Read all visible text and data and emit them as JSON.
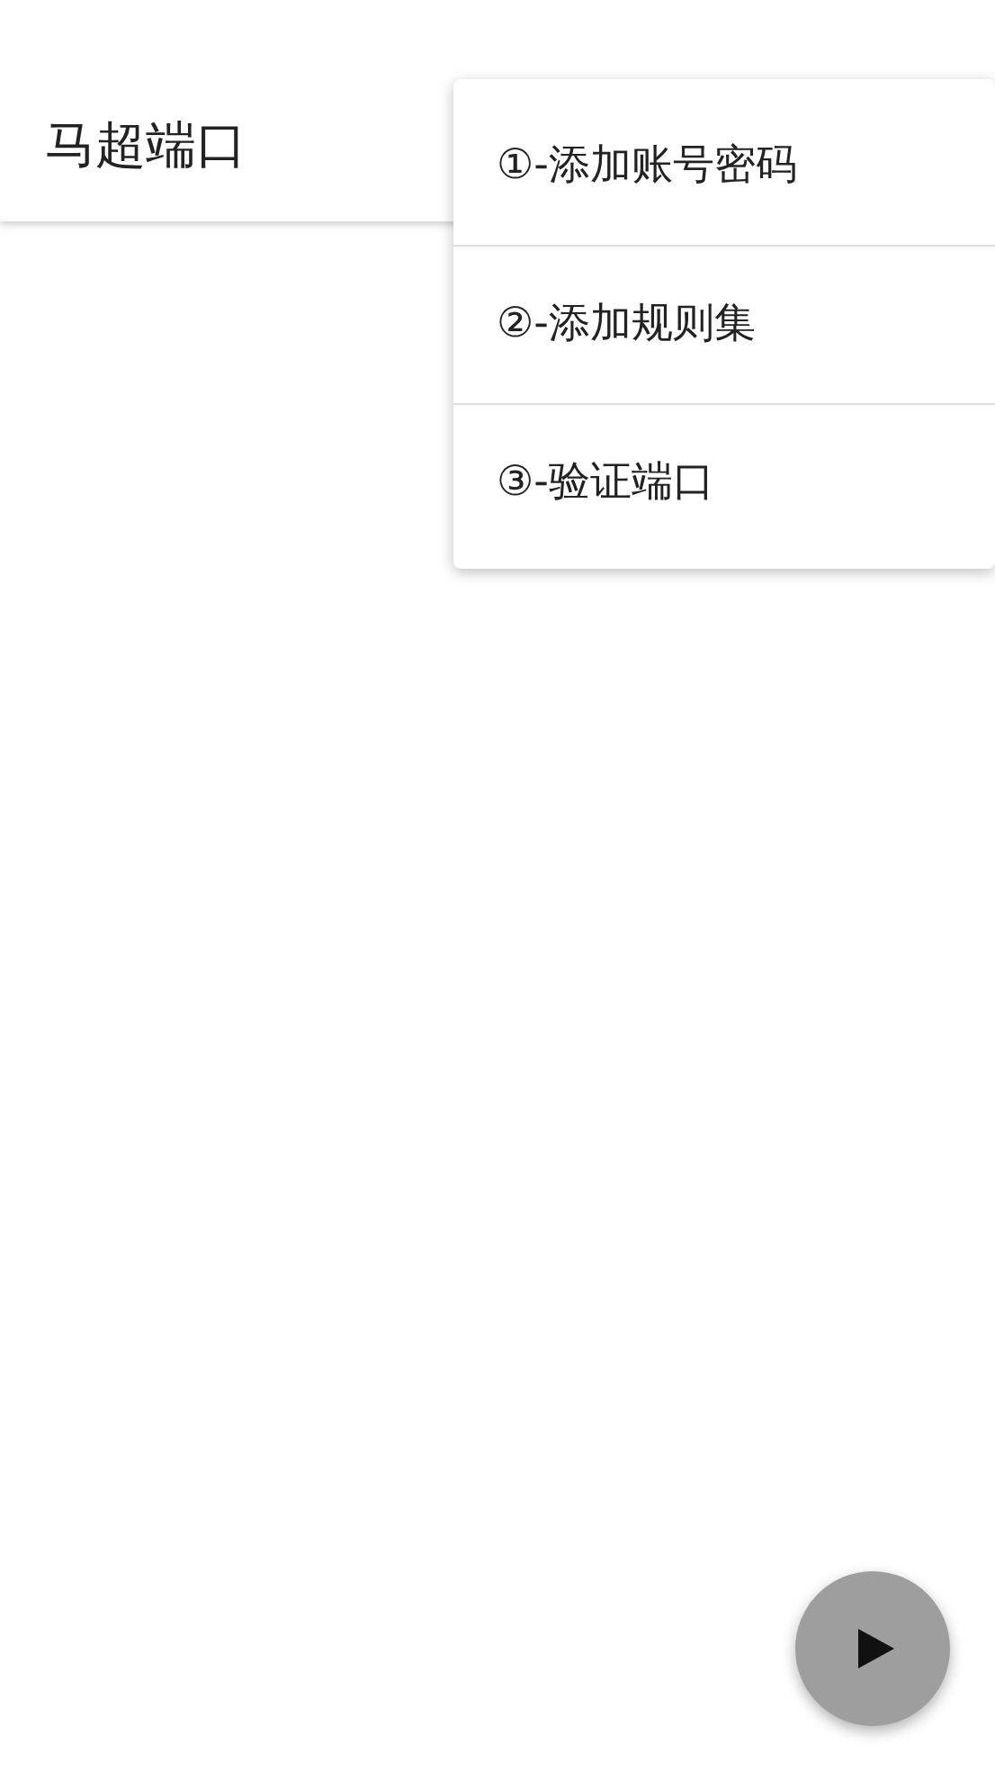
{
  "app_bar": {
    "title": "马超端口"
  },
  "menu": {
    "items": [
      {
        "label": "①-添加账号密码"
      },
      {
        "label": "②-添加规则集"
      },
      {
        "label": "③-验证端口"
      }
    ]
  },
  "fab": {
    "kind": "play"
  }
}
